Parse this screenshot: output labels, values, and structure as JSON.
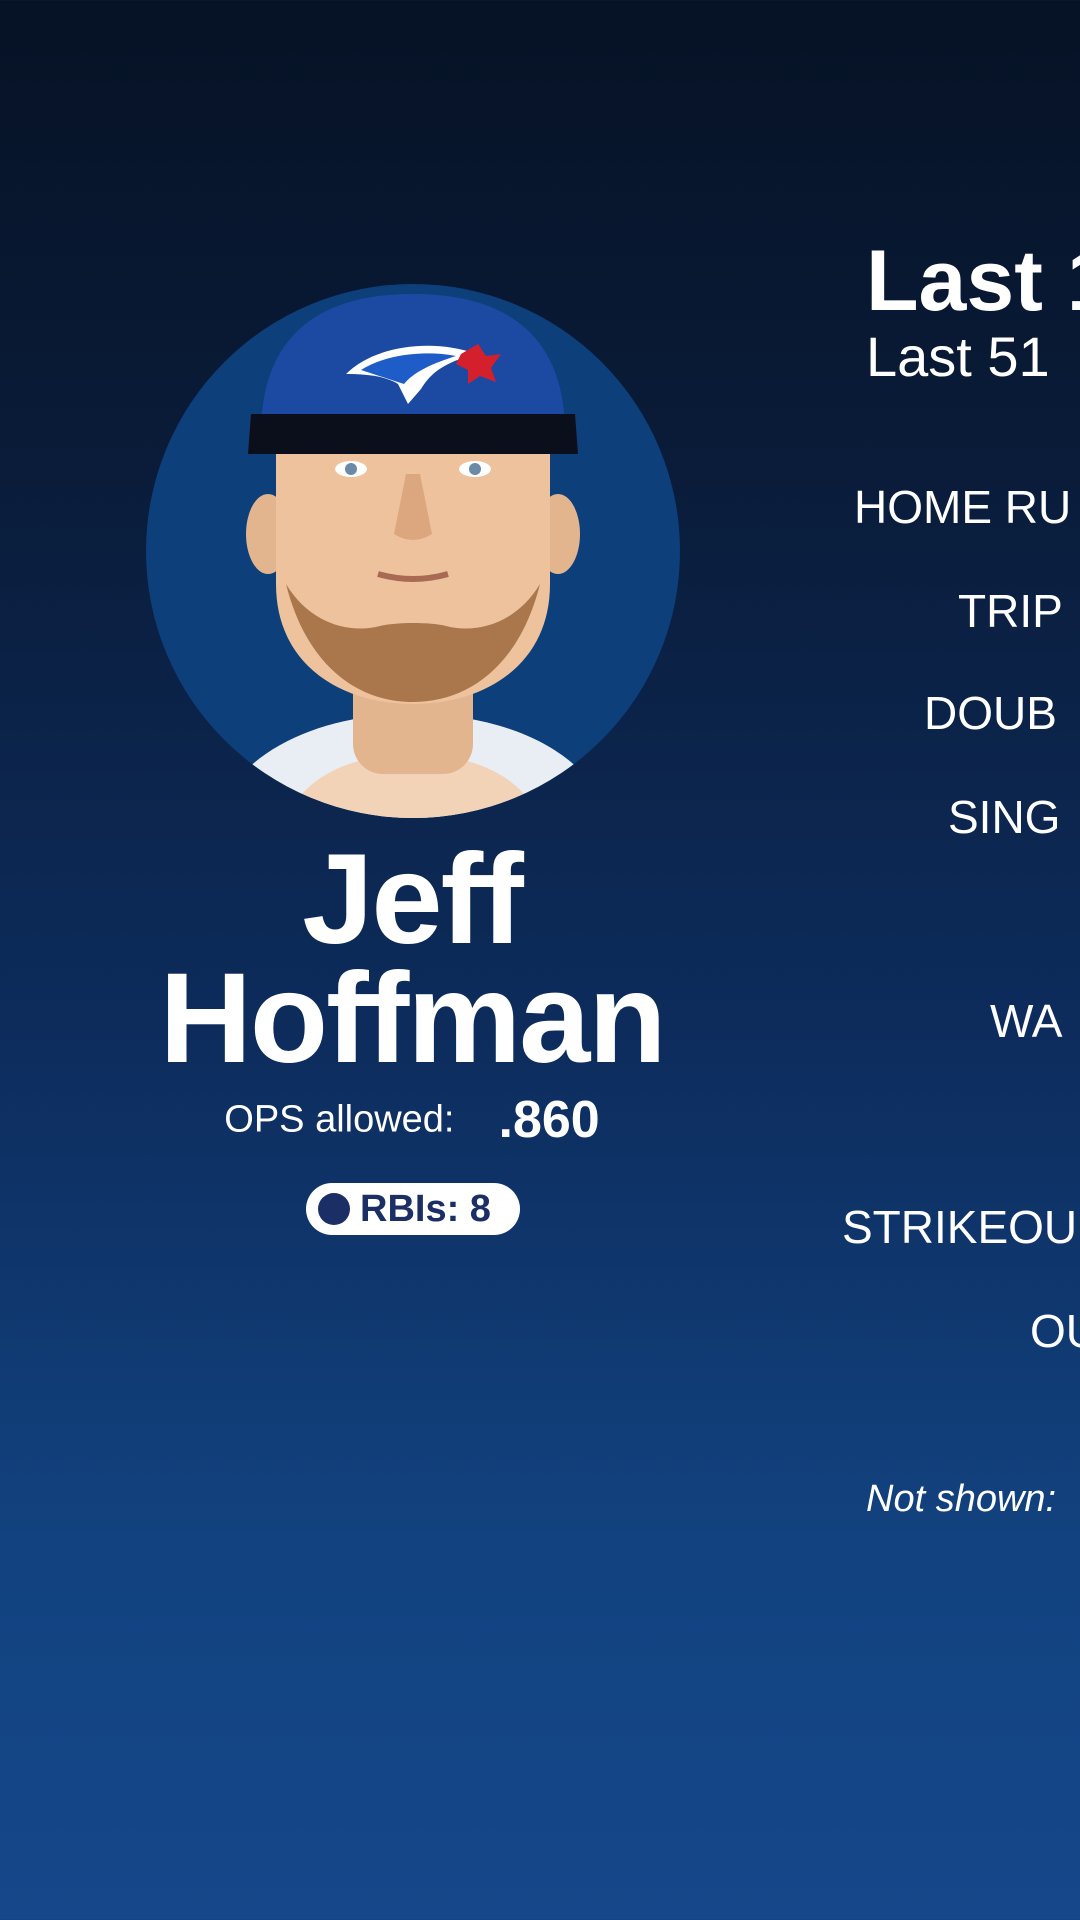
{
  "player": {
    "first_name": "Jeff",
    "last_name": "Hoffman",
    "ops_label": "OPS allowed:",
    "ops_value": ".860",
    "rbi_label": "RBIs: 8"
  },
  "panel": {
    "title": "Last 1",
    "subtitle": "Last 51",
    "stats": [
      "HOME RU",
      "TRIP",
      "DOUB",
      "SING",
      "WA",
      "STRIKEOU",
      "OU"
    ],
    "note": "Not shown:"
  },
  "colors": {
    "avatar_bg": "#0d3f7a",
    "pill_bg": "#ffffff",
    "pill_accent": "#1b2f66"
  },
  "icons": {
    "headshot": "player-headshot",
    "pill_dot": "circle-dot-icon"
  }
}
